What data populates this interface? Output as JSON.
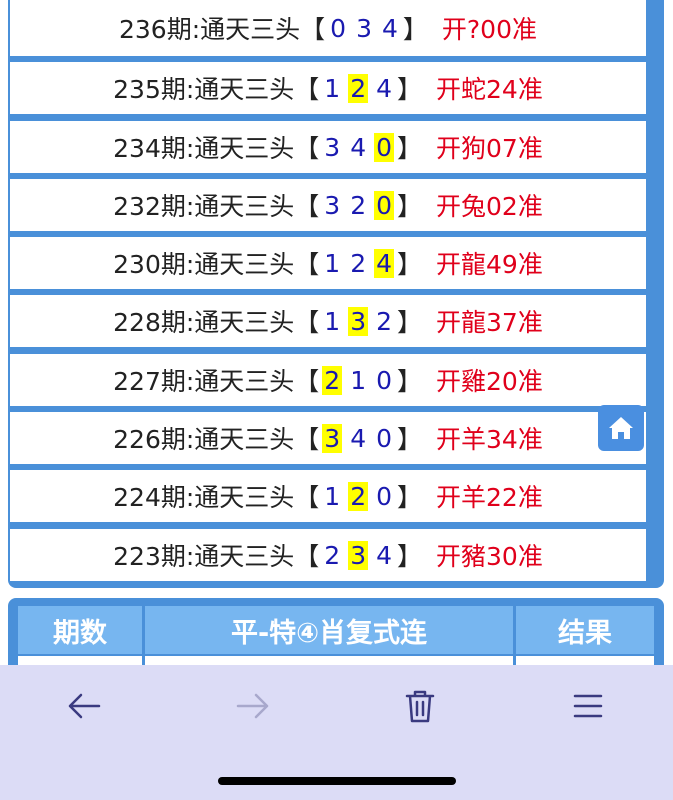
{
  "rows": [
    {
      "period": "236期:通天三头",
      "nums": [
        "0",
        "3",
        "4"
      ],
      "hl": -1,
      "result": "开?00准"
    },
    {
      "period": "235期:通天三头",
      "nums": [
        "1",
        "2",
        "4"
      ],
      "hl": 1,
      "result": "开蛇24准"
    },
    {
      "period": "234期:通天三头",
      "nums": [
        "3",
        "4",
        "0"
      ],
      "hl": 2,
      "result": "开狗07准"
    },
    {
      "period": "232期:通天三头",
      "nums": [
        "3",
        "2",
        "0"
      ],
      "hl": 2,
      "result": "开兔02准"
    },
    {
      "period": "230期:通天三头",
      "nums": [
        "1",
        "2",
        "4"
      ],
      "hl": 2,
      "result": "开龍49准"
    },
    {
      "period": "228期:通天三头",
      "nums": [
        "1",
        "3",
        "2"
      ],
      "hl": 1,
      "result": "开龍37准"
    },
    {
      "period": "227期:通天三头",
      "nums": [
        "2",
        "1",
        "0"
      ],
      "hl": 0,
      "result": "开雞20准"
    },
    {
      "period": "226期:通天三头",
      "nums": [
        "3",
        "4",
        "0"
      ],
      "hl": 0,
      "result": "开羊34准"
    },
    {
      "period": "224期:通天三头",
      "nums": [
        "1",
        "2",
        "0"
      ],
      "hl": 1,
      "result": "开羊22准"
    },
    {
      "period": "223期:通天三头",
      "nums": [
        "2",
        "3",
        "4"
      ],
      "hl": 1,
      "result": "开豬30准"
    }
  ],
  "bracket_open": "【",
  "bracket_close": "】",
  "table2": {
    "headers": [
      "期数",
      "平-特④肖复式连",
      "结果"
    ]
  },
  "icons": {
    "home": "home-icon",
    "back": "arrow-left-icon",
    "forward": "arrow-right-icon",
    "delete": "trash-icon",
    "menu": "menu-icon"
  },
  "colors": {
    "panel": "#4a90d9",
    "number": "#1a1ab0",
    "result": "#e0001b",
    "highlight": "#ffff00"
  }
}
